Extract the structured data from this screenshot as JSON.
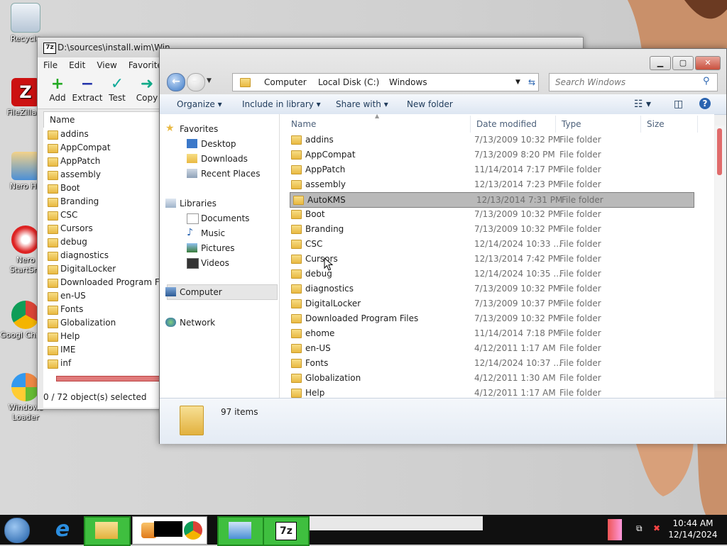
{
  "desktop": {
    "icons": [
      {
        "label": "Recycle"
      },
      {
        "label": "FileZilla C"
      },
      {
        "label": "Nero Ho"
      },
      {
        "label": "Nero StartSm"
      },
      {
        "label": "Googl Chrom"
      },
      {
        "label": "Windows Loader"
      }
    ]
  },
  "zip_window": {
    "title": "D:\\sources\\install.wim\\Win",
    "menu": [
      "File",
      "Edit",
      "View",
      "Favorites"
    ],
    "toolbar": [
      "Add",
      "Extract",
      "Test",
      "Copy"
    ],
    "list_header": "Name",
    "items": [
      "addins",
      "AppCompat",
      "AppPatch",
      "assembly",
      "Boot",
      "Branding",
      "CSC",
      "Cursors",
      "debug",
      "diagnostics",
      "DigitalLocker",
      "Downloaded Program F...",
      "en-US",
      "Fonts",
      "Globalization",
      "Help",
      "IME",
      "inf"
    ],
    "status": "0 / 72 object(s) selected"
  },
  "explorer": {
    "breadcrumb": [
      "Computer",
      "Local Disk (C:)",
      "Windows"
    ],
    "search_placeholder": "Search Windows",
    "commands": [
      "Organize",
      "Include in library",
      "Share with",
      "New folder"
    ],
    "nav": {
      "favorites": "Favorites",
      "favorites_items": [
        "Desktop",
        "Downloads",
        "Recent Places"
      ],
      "libraries": "Libraries",
      "libraries_items": [
        "Documents",
        "Music",
        "Pictures",
        "Videos"
      ],
      "computer": "Computer",
      "network": "Network"
    },
    "columns": [
      "Name",
      "Date modified",
      "Type",
      "Size"
    ],
    "rows": [
      {
        "name": "addins",
        "date": "7/13/2009 10:32 PM",
        "type": "File folder"
      },
      {
        "name": "AppCompat",
        "date": "7/13/2009 8:20 PM",
        "type": "File folder"
      },
      {
        "name": "AppPatch",
        "date": "11/14/2014 7:17 PM",
        "type": "File folder"
      },
      {
        "name": "assembly",
        "date": "12/13/2014 7:23 PM",
        "type": "File folder"
      },
      {
        "name": "AutoKMS",
        "date": "12/13/2014 7:31 PM",
        "type": "File folder",
        "selected": true
      },
      {
        "name": "Boot",
        "date": "7/13/2009 10:32 PM",
        "type": "File folder"
      },
      {
        "name": "Branding",
        "date": "7/13/2009 10:32 PM",
        "type": "File folder"
      },
      {
        "name": "CSC",
        "date": "12/14/2024 10:33 ...",
        "type": "File folder"
      },
      {
        "name": "Cursors",
        "date": "12/13/2014 7:42 PM",
        "type": "File folder"
      },
      {
        "name": "debug",
        "date": "12/14/2024 10:35 ...",
        "type": "File folder"
      },
      {
        "name": "diagnostics",
        "date": "7/13/2009 10:32 PM",
        "type": "File folder"
      },
      {
        "name": "DigitalLocker",
        "date": "7/13/2009 10:37 PM",
        "type": "File folder"
      },
      {
        "name": "Downloaded Program Files",
        "date": "7/13/2009 10:32 PM",
        "type": "File folder"
      },
      {
        "name": "ehome",
        "date": "11/14/2014 7:18 PM",
        "type": "File folder"
      },
      {
        "name": "en-US",
        "date": "4/12/2011 1:17 AM",
        "type": "File folder"
      },
      {
        "name": "Fonts",
        "date": "12/14/2024 10:37 ...",
        "type": "File folder"
      },
      {
        "name": "Globalization",
        "date": "4/12/2011 1:30 AM",
        "type": "File folder"
      },
      {
        "name": "Help",
        "date": "4/12/2011 1:17 AM",
        "type": "File folder"
      }
    ],
    "item_count": "97 items"
  },
  "taskbar": {
    "time": "10:44 AM",
    "date": "12/14/2024"
  }
}
